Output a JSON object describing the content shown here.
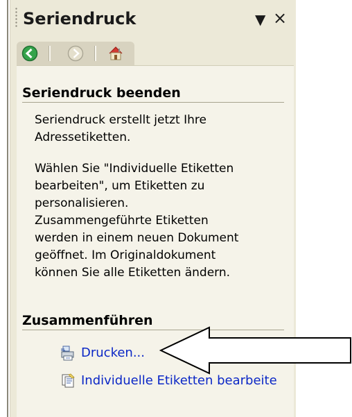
{
  "task_pane": {
    "title": "Seriendruck",
    "menu_glyph": "▼",
    "close_glyph": "×",
    "nav": {
      "back_icon": "back-icon",
      "forward_icon": "forward-icon",
      "home_icon": "home-icon"
    }
  },
  "section_finish": {
    "title": "Seriendruck beenden",
    "paragraph_1": "Seriendruck erstellt jetzt Ihre\nAdressetiketten.",
    "paragraph_2": "Wählen Sie \"Individuelle Etiketten\nbearbeiten\", um Etiketten zu\npersonalisieren.\nZusammengeführte Etiketten\nwerden in einem neuen Dokument\ngeöffnet. Im Originaldokument\nkönnen Sie alle Etiketten ändern."
  },
  "section_merge": {
    "title": "Zusammenführen",
    "print_label": "Drucken...",
    "print_icon": "printer-icon",
    "edit_label": "Individuelle Etiketten bearbeite",
    "edit_icon": "edit-labels-icon"
  },
  "colors": {
    "pane_bg": "#f5f3e9",
    "header_bg": "#ece9d8",
    "link_blue": "#0b27c6"
  }
}
